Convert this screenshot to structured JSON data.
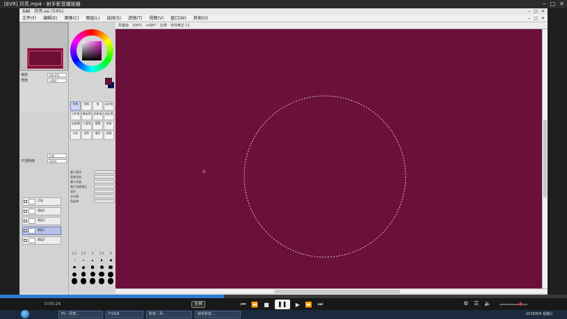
{
  "player": {
    "title": "[EVR] 月亮.mp4 - 射手影音播放器",
    "win_buttons": [
      "‒",
      "□",
      "✕"
    ]
  },
  "sai": {
    "logo": "SAI",
    "title": "月亮.sai (54%)",
    "menus": [
      "文件(F)",
      "编辑(E)",
      "图像(C)",
      "图层(L)",
      "选择(S)",
      "滤镜(T)",
      "视图(V)",
      "窗口(W)",
      "其他(O)"
    ],
    "toolbar": {
      "zoom": "100%",
      "angle": "+000°",
      "mode": "正常",
      "stabilizer_label": "手抖修正",
      "stabilizer_value": "11",
      "antialias_label": "抗锯齿"
    },
    "nav": {
      "zoom_label": "缩放",
      "zoom_value": "100.0%",
      "angle_label": "角度",
      "angle_value": "+000"
    },
    "layer_mode_label": "正常",
    "opacity_label": "不透明度",
    "opacity_value": "100%",
    "layers": [
      {
        "name": "月亮",
        "selected": false
      },
      {
        "name": "图层4",
        "selected": false
      },
      {
        "name": "图层3",
        "selected": false
      },
      {
        "name": "图层1",
        "selected": true
      },
      {
        "name": "图层2",
        "selected": false
      }
    ],
    "tools": [
      "铅笔",
      "喷枪",
      "笔",
      "水彩笔",
      "马克笔",
      "橡皮擦",
      "选取笔",
      "选区擦",
      "油漆桶",
      "二值笔",
      "模糊",
      "抹笔",
      "水彩",
      "混色",
      "填色",
      "画笔"
    ],
    "brush_opts": [
      "最小直径",
      "画笔浓度",
      "最小浓度",
      "最大浓度笔压",
      "混色",
      "水分量",
      "色延伸"
    ],
    "brush_sizes": [
      "2.2",
      "2.5",
      "3",
      "3.5",
      "4"
    ]
  },
  "colors": {
    "canvas": "#6b0f3b",
    "foreground": "#6e0f34",
    "background": "#0b0b70",
    "progress": "#2d7bd1"
  },
  "controls": {
    "time": "0:00:24",
    "fullscreen": "全屏",
    "prev_icon": "⏮",
    "rewind_icon": "⏪",
    "stop_icon": "■",
    "play_icon": "❚❚",
    "next_icon": "▶",
    "ffwd_icon": "⏩",
    "last_icon": "⏭"
  },
  "taskbar": {
    "tasks": [
      "PS - 月亮...",
      "F:\\018",
      "影音 - 月...",
      "射手影音..."
    ],
    "clock": "2018/6/6 星期三"
  },
  "playback": {
    "progress": 0.395
  }
}
